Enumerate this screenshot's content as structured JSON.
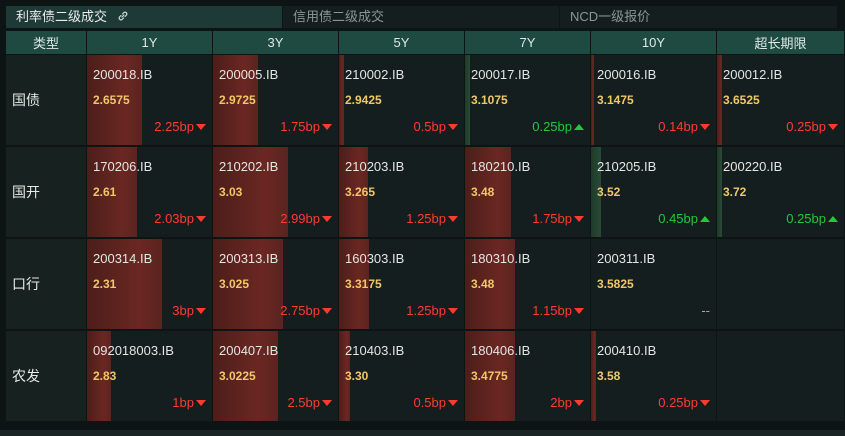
{
  "tabs": [
    {
      "label": "利率债二级成交",
      "active": true
    },
    {
      "label": "信用债二级成交",
      "active": false
    },
    {
      "label": "NCD一级报价",
      "active": false
    }
  ],
  "headers": [
    "类型",
    "1Y",
    "3Y",
    "5Y",
    "7Y",
    "10Y",
    "超长期限"
  ],
  "rows": [
    {
      "type": "国债",
      "cells": [
        {
          "code": "200018.IB",
          "yield": "2.6575",
          "change": "2.25bp",
          "dir": "up",
          "bar": 0.44
        },
        {
          "code": "200005.IB",
          "yield": "2.9725",
          "change": "1.75bp",
          "dir": "up",
          "bar": 0.36
        },
        {
          "code": "210002.IB",
          "yield": "2.9425",
          "change": "0.5bp",
          "dir": "up",
          "bar": 0.04
        },
        {
          "code": "200017.IB",
          "yield": "3.1075",
          "change": "0.25bp",
          "dir": "down",
          "bar": 0.04
        },
        {
          "code": "200016.IB",
          "yield": "3.1475",
          "change": "0.14bp",
          "dir": "up",
          "bar": 0.02
        },
        {
          "code": "200012.IB",
          "yield": "3.6525",
          "change": "0.25bp",
          "dir": "up",
          "bar": 0.04
        }
      ]
    },
    {
      "type": "国开",
      "cells": [
        {
          "code": "170206.IB",
          "yield": "2.61",
          "change": "2.03bp",
          "dir": "up",
          "bar": 0.4
        },
        {
          "code": "210202.IB",
          "yield": "3.03",
          "change": "2.99bp",
          "dir": "up",
          "bar": 0.6
        },
        {
          "code": "210203.IB",
          "yield": "3.265",
          "change": "1.25bp",
          "dir": "up",
          "bar": 0.23
        },
        {
          "code": "180210.IB",
          "yield": "3.48",
          "change": "1.75bp",
          "dir": "up",
          "bar": 0.37
        },
        {
          "code": "210205.IB",
          "yield": "3.52",
          "change": "0.45bp",
          "dir": "down",
          "bar": 0.08
        },
        {
          "code": "200220.IB",
          "yield": "3.72",
          "change": "0.25bp",
          "dir": "down",
          "bar": 0.04
        }
      ]
    },
    {
      "type": "口行",
      "cells": [
        {
          "code": "200314.IB",
          "yield": "2.31",
          "change": "3bp",
          "dir": "up",
          "bar": 0.6
        },
        {
          "code": "200313.IB",
          "yield": "3.025",
          "change": "2.75bp",
          "dir": "up",
          "bar": 0.56
        },
        {
          "code": "160303.IB",
          "yield": "3.3175",
          "change": "1.25bp",
          "dir": "up",
          "bar": 0.24
        },
        {
          "code": "180310.IB",
          "yield": "3.48",
          "change": "1.15bp",
          "dir": "up",
          "bar": 0.4
        },
        {
          "code": "200311.IB",
          "yield": "3.5825",
          "change": "--",
          "dir": "flat",
          "bar": 0
        },
        null
      ]
    },
    {
      "type": "农发",
      "cells": [
        {
          "code": "092018003.IB",
          "yield": "2.83",
          "change": "1bp",
          "dir": "up",
          "bar": 0.19
        },
        {
          "code": "200407.IB",
          "yield": "3.0225",
          "change": "2.5bp",
          "dir": "up",
          "bar": 0.52
        },
        {
          "code": "210403.IB",
          "yield": "3.30",
          "change": "0.5bp",
          "dir": "up",
          "bar": 0.09
        },
        {
          "code": "180406.IB",
          "yield": "3.4775",
          "change": "2bp",
          "dir": "up",
          "bar": 0.4
        },
        {
          "code": "200410.IB",
          "yield": "3.58",
          "change": "0.25bp",
          "dir": "up",
          "bar": 0.04
        },
        null
      ]
    }
  ],
  "colors": {
    "up": "#ff3b30",
    "down": "#22c93a",
    "yield": "#f1c867",
    "header": "#1f4a42"
  }
}
